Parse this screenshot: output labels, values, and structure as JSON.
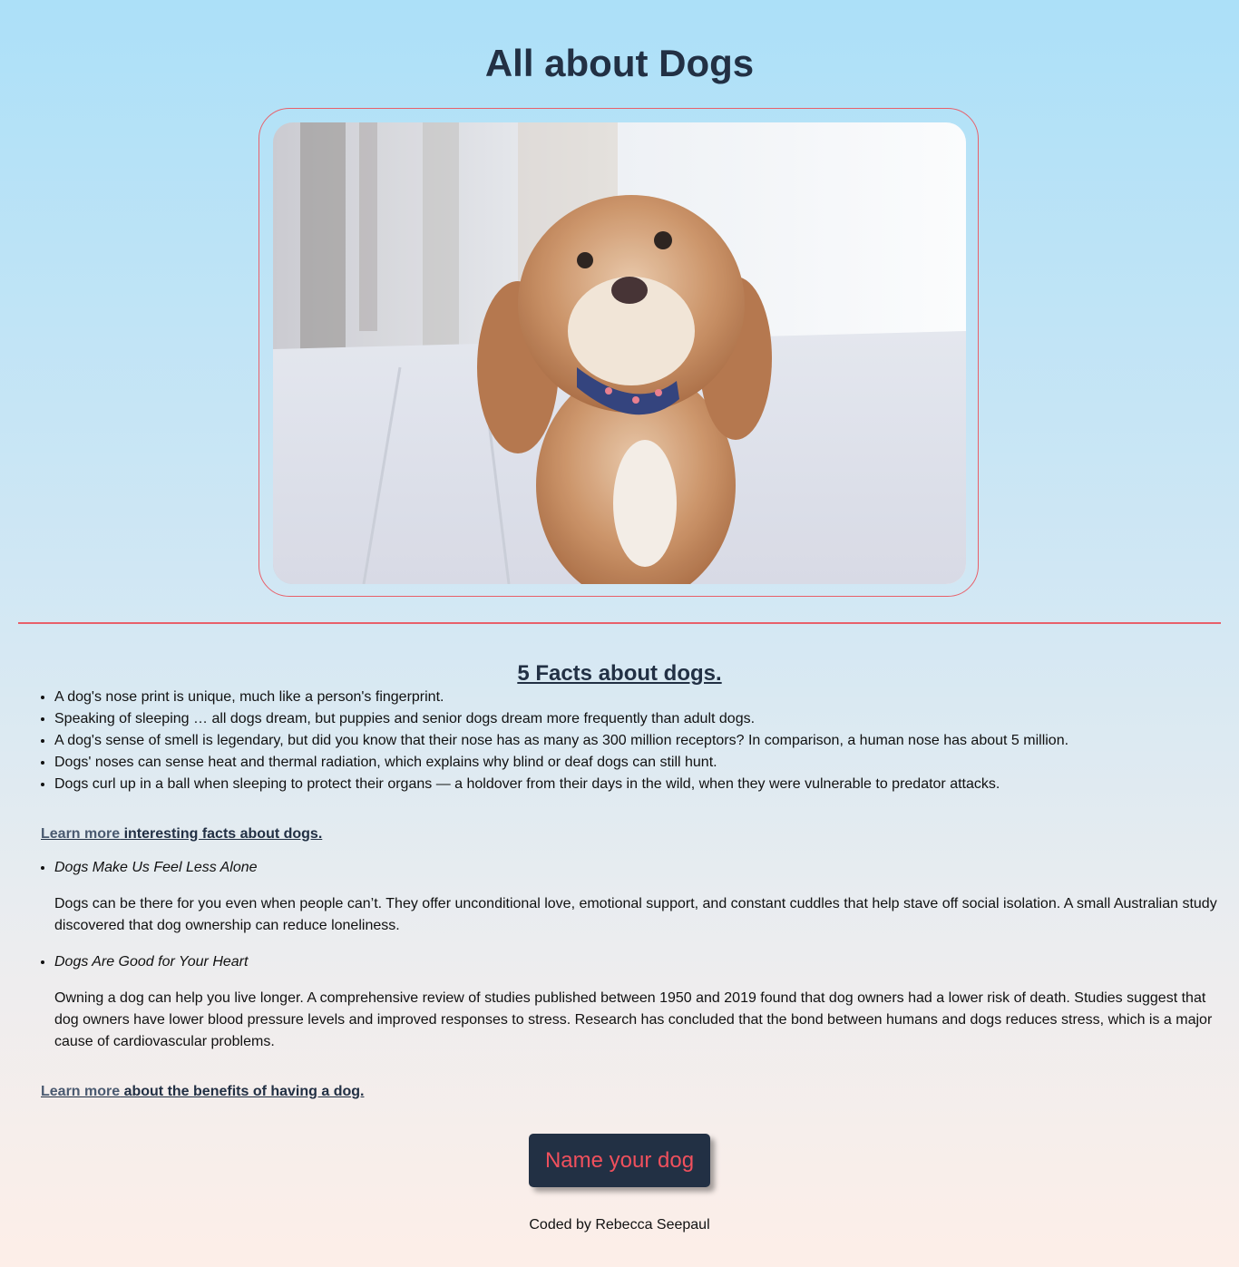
{
  "header": {
    "title": "All about Dogs"
  },
  "photo": {
    "subject": "fluffy tan dog with blue collar",
    "icon": "dog-photo"
  },
  "facts": {
    "heading": "5 Facts about dogs.",
    "items": [
      "A dog's nose print is unique, much like a person's fingerprint.",
      "Speaking of sleeping … all dogs dream, but puppies and senior dogs dream more frequently than adult dogs.",
      "A dog's sense of smell is legendary, but did you know that their nose has as many as 300 million receptors? In comparison, a human nose has about 5 million.",
      "Dogs' noses can sense heat and thermal radiation, which explains why blind or deaf dogs can still hunt.",
      "Dogs curl up in a ball when sleeping to protect their organs — a holdover from their days in the wild, when they were vulnerable to predator attacks."
    ]
  },
  "learn_more_facts": {
    "link_text": "Learn more",
    "rest": " interesting facts about dogs."
  },
  "benefits": [
    {
      "title": "Dogs Make Us Feel Less Alone",
      "body": "Dogs can be there for you even when people can’t. They offer unconditional love, emotional support, and constant cuddles that help stave off social isolation. A small Australian study discovered that dog ownership can reduce loneliness."
    },
    {
      "title": "Dogs Are Good for Your Heart",
      "body": "Owning a dog can help you live longer. A comprehensive review of studies published between 1950 and 2019 found that dog owners had a lower risk of death. Studies suggest that dog owners have lower blood pressure levels and improved responses to stress. Research has concluded that the bond between humans and dogs reduces stress, which is a major cause of cardiovascular problems."
    }
  ],
  "learn_more_benefits": {
    "link_text": "Learn more",
    "rest": " about the benefits of having a dog."
  },
  "button": {
    "label": "Name your dog"
  },
  "footer": {
    "credit": "Coded by Rebecca Seepaul"
  },
  "colors": {
    "accent": "#e8606a",
    "dark": "#223044",
    "button_text": "#f0505d"
  }
}
